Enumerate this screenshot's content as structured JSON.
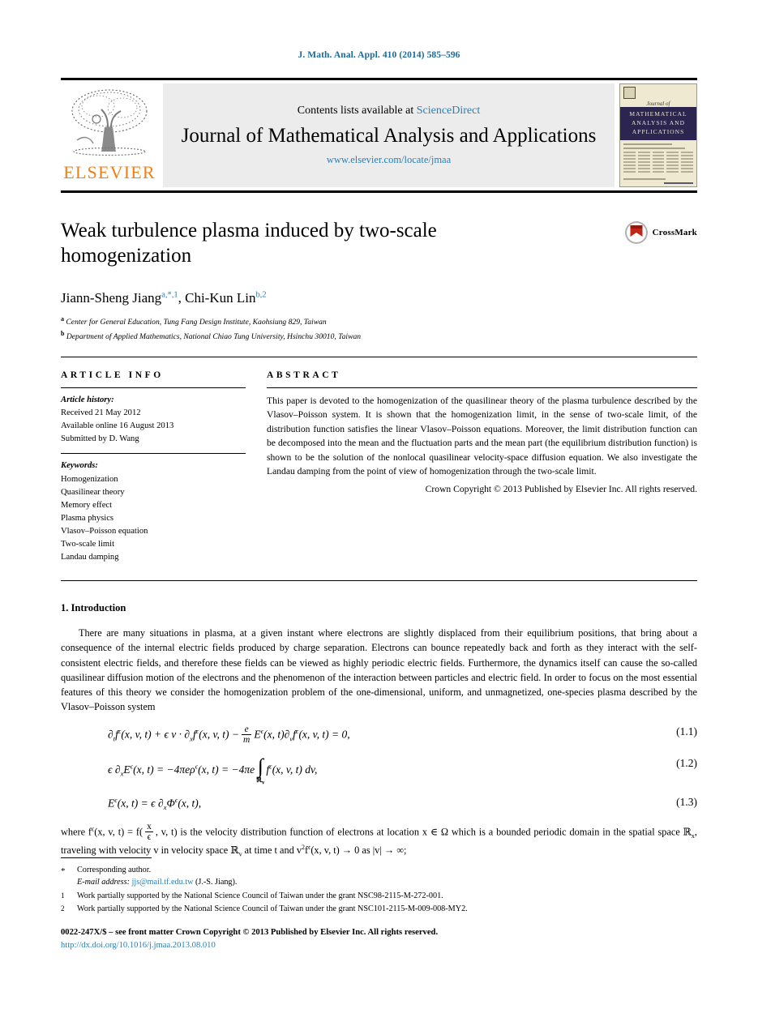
{
  "running_head": "J. Math. Anal. Appl. 410 (2014) 585–596",
  "masthead": {
    "publisher_name": "ELSEVIER",
    "contents_prefix": "Contents lists available at ",
    "contents_link": "ScienceDirect",
    "journal_title": "Journal of Mathematical Analysis and Applications",
    "journal_url": "www.elsevier.com/locate/jmaa",
    "cover": {
      "journal_of": "Journal of",
      "band_line1": "MATHEMATICAL",
      "band_line2": "ANALYSIS AND",
      "band_line3": "APPLICATIONS"
    }
  },
  "article": {
    "title": "Weak turbulence plasma induced by two-scale homogenization",
    "crossmark_label": "CrossMark",
    "authors": [
      {
        "name": "Jiann-Sheng Jiang",
        "marks": "a,*,1"
      },
      {
        "name": "Chi-Kun Lin",
        "marks": "b,2"
      }
    ],
    "authors_separator": ", ",
    "affiliations": [
      {
        "mark": "a",
        "text": "Center for General Education, Tung Fang Design Institute, Kaohsiung 829, Taiwan"
      },
      {
        "mark": "b",
        "text": "Department of Applied Mathematics, National Chiao Tung University, Hsinchu 30010, Taiwan"
      }
    ]
  },
  "info": {
    "label": "ARTICLE INFO",
    "history_head": "Article history:",
    "history": [
      "Received 21 May 2012",
      "Available online 16 August 2013",
      "Submitted by D. Wang"
    ],
    "keywords_head": "Keywords:",
    "keywords": [
      "Homogenization",
      "Quasilinear theory",
      "Memory effect",
      "Plasma physics",
      "Vlasov–Poisson equation",
      "Two-scale limit",
      "Landau damping"
    ]
  },
  "abstract": {
    "label": "ABSTRACT",
    "text": "This paper is devoted to the homogenization of the quasilinear theory of the plasma turbulence described by the Vlasov–Poisson system. It is shown that the homogenization limit, in the sense of two-scale limit, of the distribution function satisfies the linear Vlasov–Poisson equations. Moreover, the limit distribution function can be decomposed into the mean and the fluctuation parts and the mean part (the equilibrium distribution function) is shown to be the solution of the nonlocal quasilinear velocity-space diffusion equation. We also investigate the Landau damping from the point of view of homogenization through the two-scale limit.",
    "copyright": "Crown Copyright © 2013 Published by Elsevier Inc. All rights reserved."
  },
  "body": {
    "section_number_title": "1. Introduction",
    "paragraph1": "There are many situations in plasma, at a given instant where electrons are slightly displaced from their equilibrium positions, that bring about a consequence of the internal electric fields produced by charge separation. Electrons can bounce repeatedly back and forth as they interact with the self-consistent electric fields, and therefore these fields can be viewed as highly periodic electric fields. Furthermore, the dynamics itself can cause the so-called quasilinear diffusion motion of the electrons and the phenomenon of the interaction between particles and electric field. In order to focus on the most essential features of this theory we consider the homogenization problem of the one-dimensional, uniform, and unmagnetized, one-species plasma described by the Vlasov–Poisson system",
    "equations": [
      {
        "number": "(1.1)"
      },
      {
        "number": "(1.2)"
      },
      {
        "number": "(1.3)"
      }
    ],
    "eq1_parts": {
      "p1": "∂",
      "p1sub": "t",
      "p2": "f",
      "p2sup": "ϵ",
      "p3": "(x, v, t) + ϵ v · ∂",
      "p3sub": "x",
      "p4": "f",
      "p4sup": "ϵ",
      "p5": "(x, v, t) −",
      "frac_num": "e",
      "frac_den": "m",
      "p6": "E",
      "p6sup": "ϵ",
      "p7": "(x, t)∂",
      "p7sub": "v",
      "p8": "f",
      "p8sup": "ϵ",
      "p9": "(x, v, t) = 0,"
    },
    "eq2_parts": {
      "p1": "ϵ ∂",
      "p1sub": "x",
      "p2": "E",
      "p2sup": "ϵ",
      "p3": "(x, t) = −4πeρ",
      "p3sup": "ϵ",
      "p4": "(x, t) = −4πe",
      "int_limit": "ℝ",
      "int_limit_sub": "v",
      "p5": "f",
      "p5sup": "ϵ",
      "p6": "(x, v, t) dv,"
    },
    "eq3_parts": {
      "p1": "E",
      "p1sup": "ϵ",
      "p2": "(x, t) = ϵ ∂",
      "p2sub": "x",
      "p3": "Φ",
      "p3sup": "ϵ",
      "p4": "(x, t),"
    },
    "paragraph2_a": "where  f",
    "paragraph2_b": "(x, v, t) = f(",
    "paragraph2_c": ", v, t) is the velocity distribution function of electrons at location x ∈ Ω which is a bounded periodic domain in the spatial space ℝ",
    "paragraph2_d": ", traveling with velocity v in velocity space ℝ",
    "paragraph2_e": " at time t and v",
    "paragraph2_f": "f",
    "paragraph2_g": "(x, v, t) → 0 as |v| → ∞;"
  },
  "footnotes": [
    {
      "mark": "*",
      "text": "Corresponding author.",
      "email_prefix": "E-mail address: ",
      "email": "jjs@mail.tf.edu.tw",
      "email_suffix": " (J.-S. Jiang)."
    },
    {
      "mark": "1",
      "text": "Work partially supported by the National Science Council of Taiwan under the grant NSC98-2115-M-272-001."
    },
    {
      "mark": "2",
      "text": "Work partially supported by the National Science Council of Taiwan under the grant NSC101-2115-M-009-008-MY2."
    }
  ],
  "colophon": {
    "issn_line": "0022-247X/$ – see front matter  Crown Copyright © 2013 Published by Elsevier Inc. All rights reserved.",
    "doi": "http://dx.doi.org/10.1016/j.jmaa.2013.08.010"
  },
  "colors": {
    "link": "#2a7fb5",
    "running_head": "#1a6a9a",
    "elsevier_orange": "#f07f16",
    "cover_band": "#2b2550",
    "band_bg": "#ececec"
  }
}
